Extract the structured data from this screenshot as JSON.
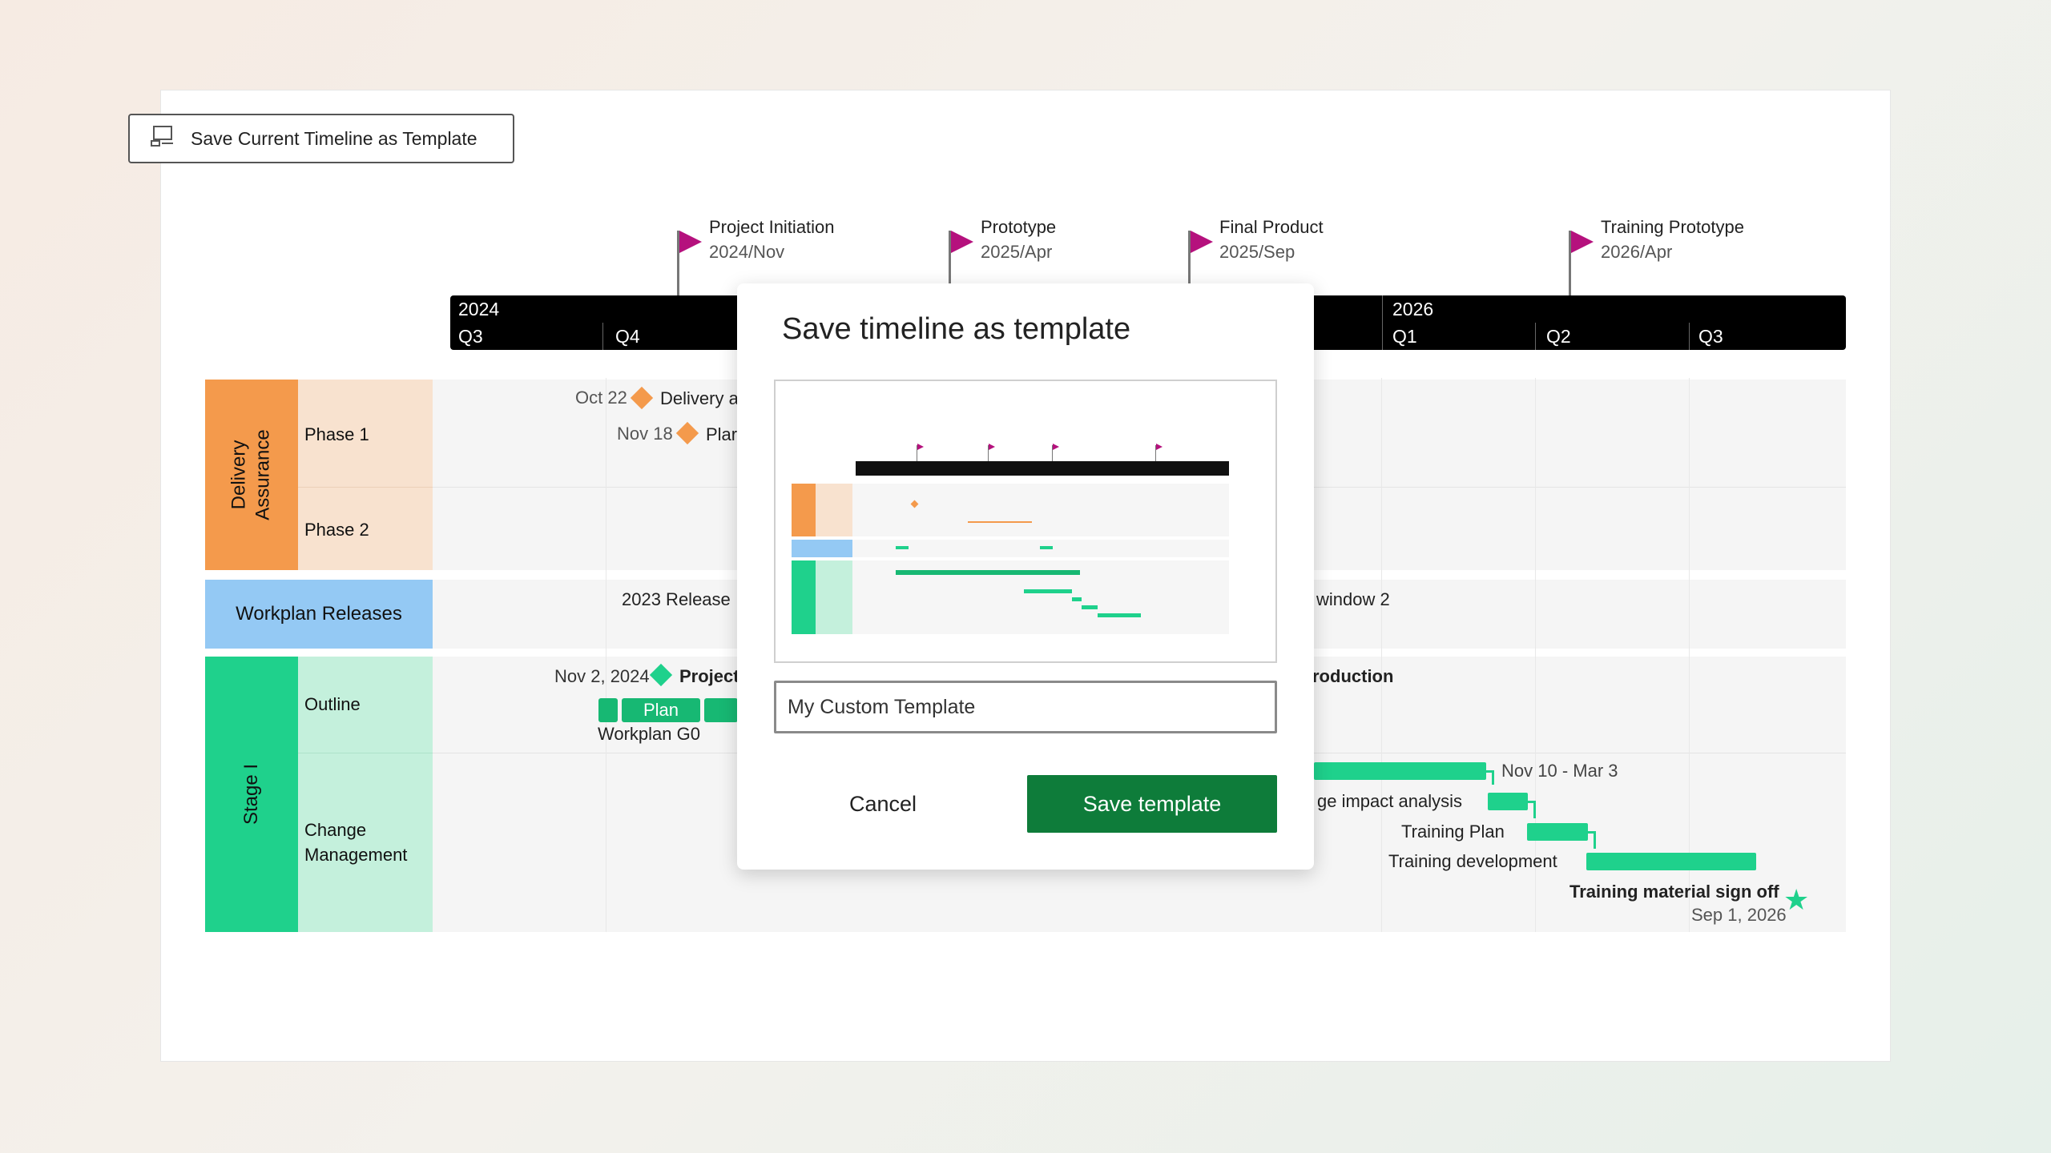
{
  "toolbar": {
    "save_current_label": "Save Current Timeline as Template"
  },
  "milestones": [
    {
      "label": "Project Initiation",
      "date": "2024/Nov"
    },
    {
      "label": "Prototype",
      "date": "2025/Apr"
    },
    {
      "label": "Final Product",
      "date": "2025/Sep"
    },
    {
      "label": "Training Prototype",
      "date": "2026/Apr"
    }
  ],
  "timescale": {
    "years": [
      "2024",
      "2026"
    ],
    "quarters": [
      "Q3",
      "Q4",
      "Q1",
      "Q2",
      "Q3"
    ]
  },
  "swimlanes": {
    "delivery": {
      "title": "Delivery\nAssurance",
      "phase1": "Phase 1",
      "phase2": "Phase 2"
    },
    "workplan": {
      "title": "Workplan Releases"
    },
    "stage": {
      "title": "Stage I",
      "outline": "Outline",
      "change": "Change\nManagement"
    }
  },
  "tasks": {
    "oct22_date": "Oct 22",
    "oct22_label": "Delivery a",
    "nov18_date": "Nov 18",
    "nov18_label": "Plar",
    "release_2023": "2023 Release",
    "release_window2": "window 2",
    "nov2_date": "Nov 2, 2024",
    "nov2_label": "Project",
    "production": "roduction",
    "plan_bar": "Plan",
    "workplan_g0": "Workplan G0",
    "nov10_range": "Nov 10 - Mar 3",
    "impact": "ge impact analysis",
    "training_plan": "Training Plan",
    "training_dev": "Training development",
    "signoff": "Training material sign off",
    "signoff_date": "Sep 1, 2026"
  },
  "modal": {
    "title": "Save timeline as template",
    "input_value": "My Custom Template",
    "cancel_label": "Cancel",
    "save_label": "Save template"
  },
  "colors": {
    "flag": "#b5117d",
    "delivery": "#f49a4c",
    "delivery_light": "#f8e2cf",
    "workplan": "#94c9f4",
    "stage": "#1fd18c",
    "stage_light": "#c4f0dc",
    "save_button": "#0e7c3a"
  }
}
